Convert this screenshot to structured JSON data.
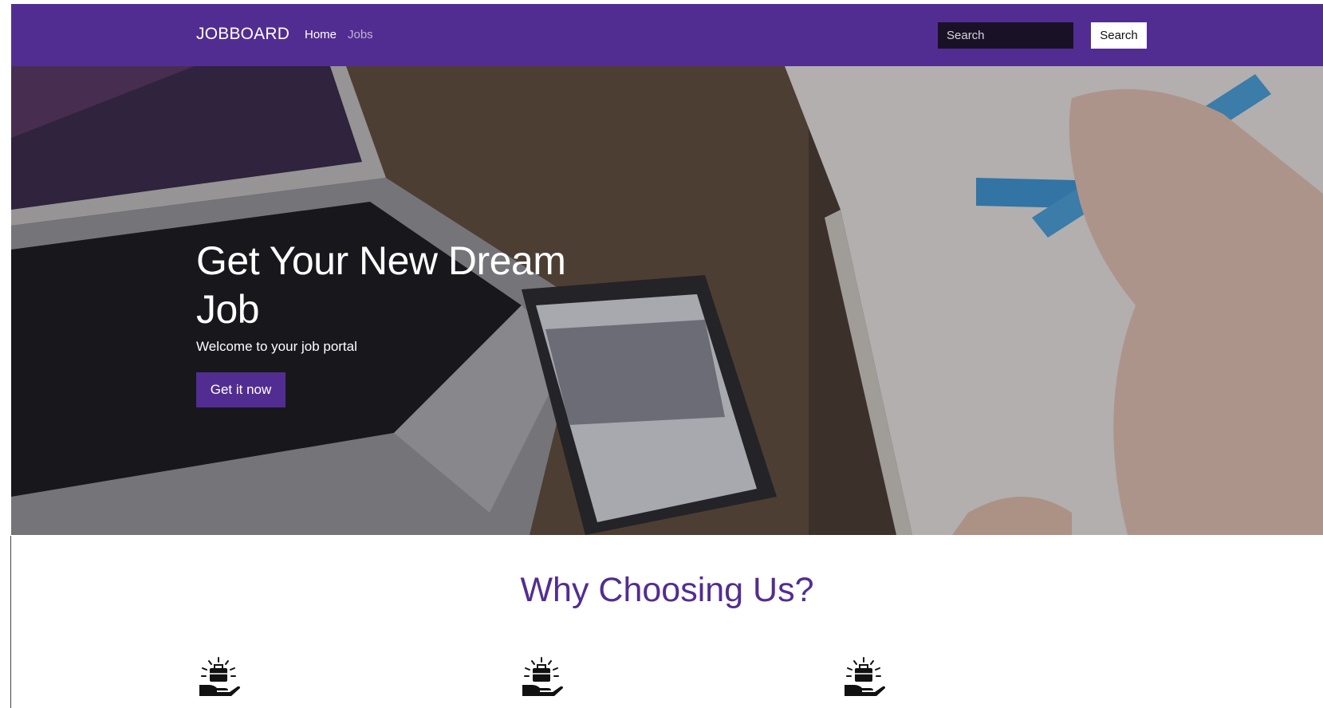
{
  "navbar": {
    "brand": "JOBBOARD",
    "links": [
      {
        "label": "Home",
        "active": true
      },
      {
        "label": "Jobs",
        "active": false
      }
    ],
    "search": {
      "placeholder": "Search",
      "button_label": "Search"
    }
  },
  "hero": {
    "title": "Get Your New Dream Job",
    "subtitle": "Welcome to your job portal",
    "cta_label": "Get it now",
    "background": "photo of a laptop, smartphone and a hand writing in a notebook on a wooden desk"
  },
  "features": {
    "title": "Why Choosing Us?",
    "icons": [
      "briefcase-hand-icon",
      "briefcase-hand-icon",
      "briefcase-hand-icon"
    ]
  },
  "colors": {
    "brand_purple": "#522d91",
    "nav_link_inactive": "#c0b2da",
    "search_input_bg": "#191226"
  }
}
